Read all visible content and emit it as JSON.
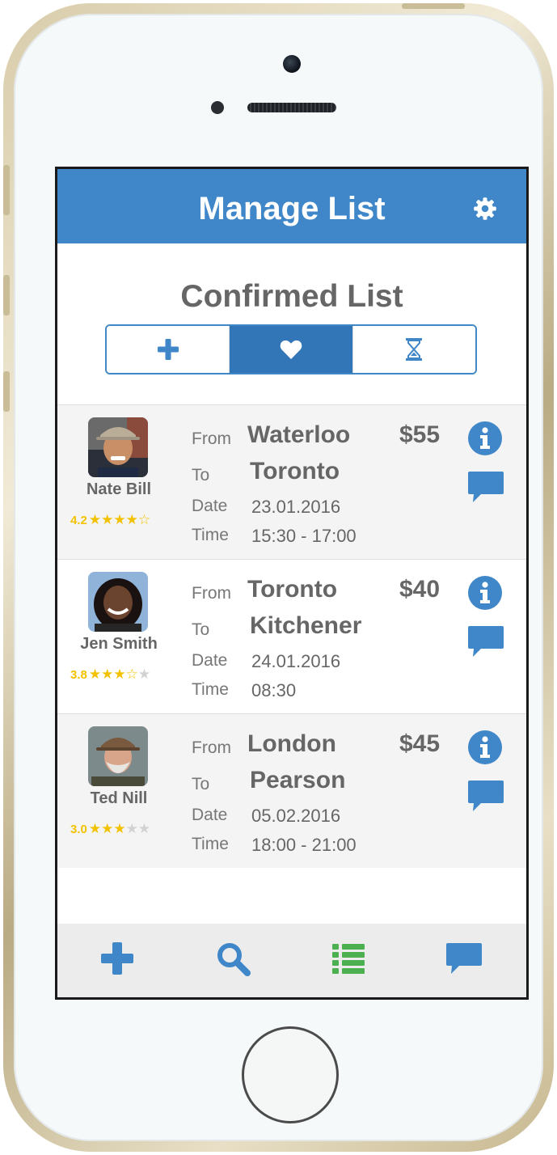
{
  "header": {
    "title": "Manage List",
    "settings_icon": "gear-icon"
  },
  "list": {
    "title": "Confirmed List",
    "segments": [
      {
        "icon": "plus-icon",
        "active": false
      },
      {
        "icon": "heart-icon",
        "active": true
      },
      {
        "icon": "hourglass-icon",
        "active": false
      }
    ]
  },
  "labels": {
    "from": "From",
    "to": "To",
    "date": "Date",
    "time": "Time"
  },
  "rides": [
    {
      "driver": "Nate Bill",
      "rating": "4.2",
      "stars": "★★★★☆",
      "stars_off": "",
      "from": "Waterloo",
      "to": "Toronto",
      "date": "23.01.2016",
      "time": "15:30 - 17:00",
      "price": "$55"
    },
    {
      "driver": "Jen Smith",
      "rating": "3.8",
      "stars": "★★★☆",
      "stars_off": "★",
      "from": "Toronto",
      "to": "Kitchener",
      "date": "24.01.2016",
      "time": "08:30",
      "price": "$40"
    },
    {
      "driver": "Ted Nill",
      "rating": "3.0",
      "stars": "★★★",
      "stars_off": "★★",
      "from": "London",
      "to": "Pearson",
      "date": "05.02.2016",
      "time": "18:00 - 21:00",
      "price": "$45"
    }
  ],
  "tabbar": [
    "plus-icon",
    "search-icon",
    "list-icon",
    "chat-icon"
  ],
  "colors": {
    "primary": "#3f87c8",
    "active_segment": "#3276b8",
    "star": "#f2c200",
    "list_icon": "#4caf50"
  }
}
